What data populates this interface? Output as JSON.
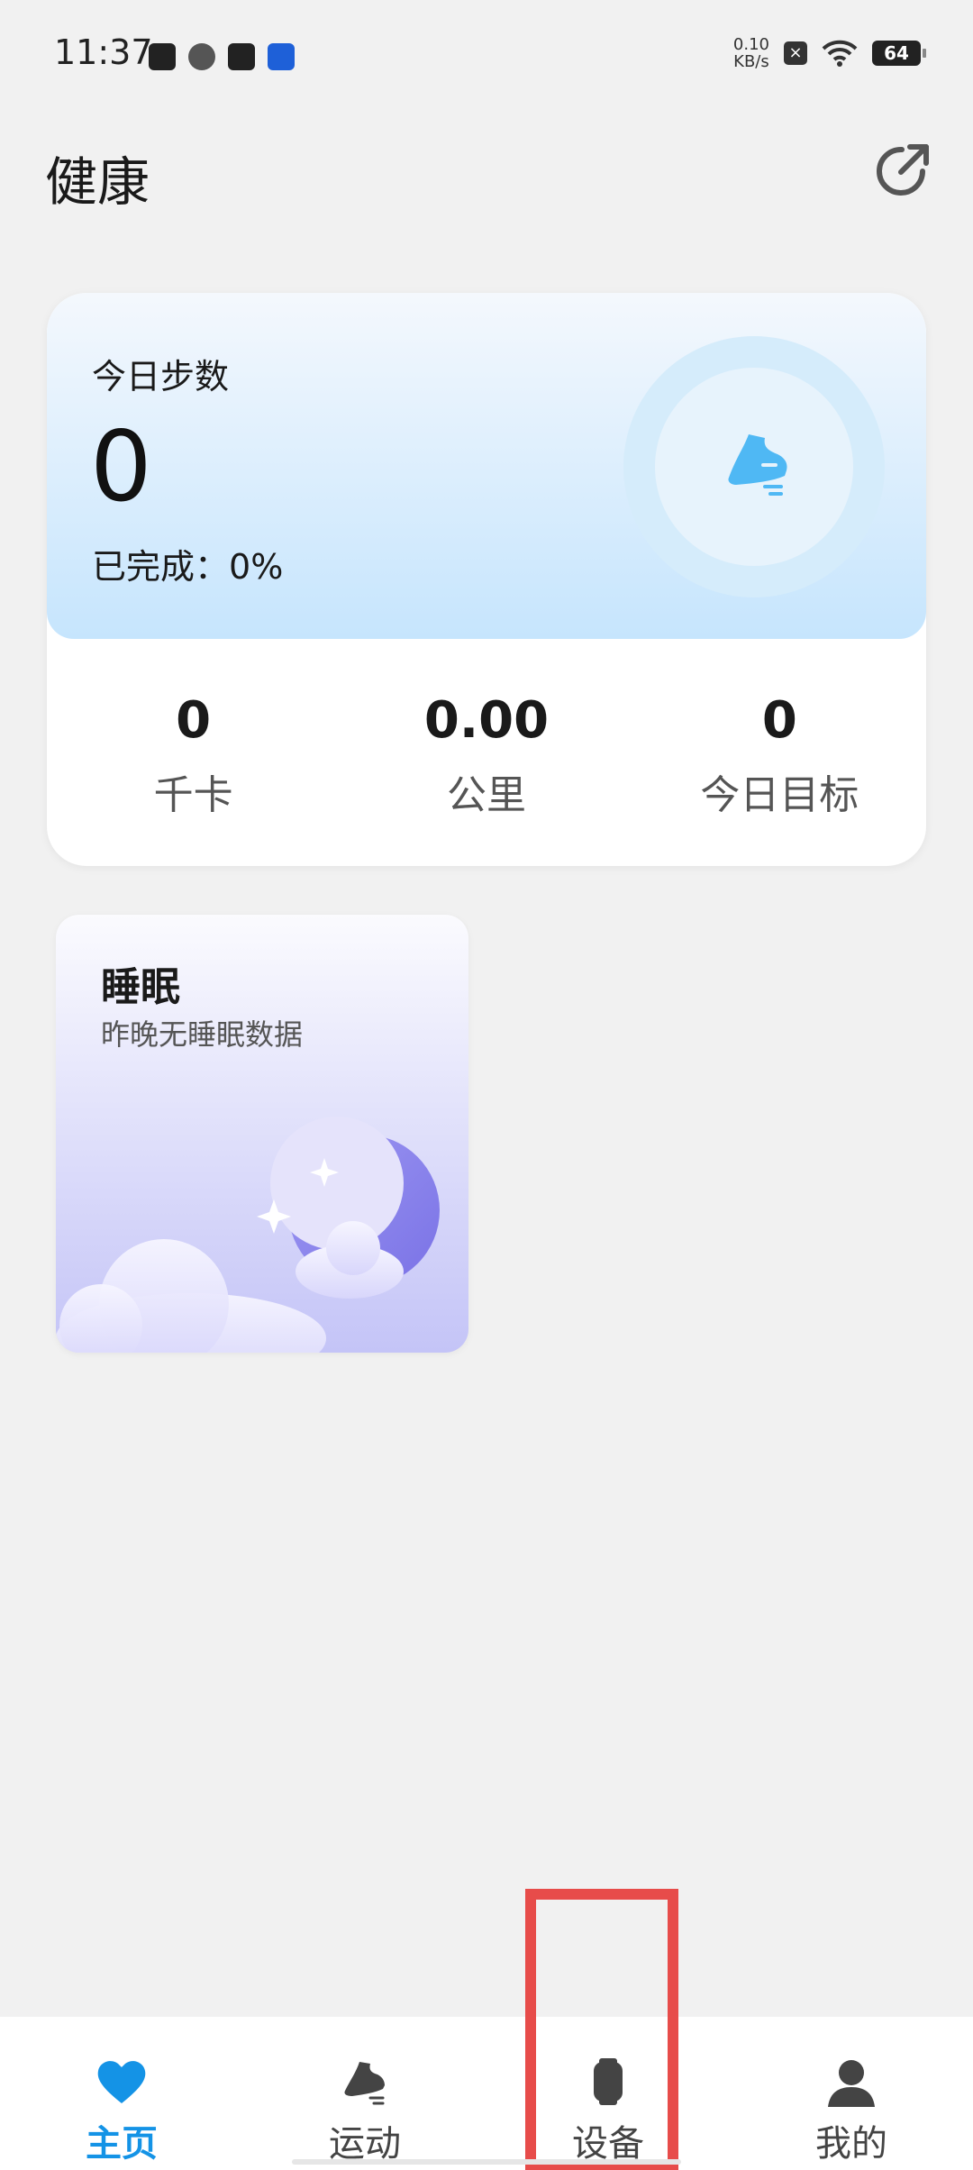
{
  "status_bar": {
    "time": "11:37",
    "net_speed_value": "0.10",
    "net_speed_unit": "KB/s",
    "battery": "64"
  },
  "header": {
    "title": "健康"
  },
  "steps_card": {
    "label": "今日步数",
    "value": "0",
    "completed_label": "已完成：",
    "completed_value": "0%",
    "progress_percent": 0,
    "stats": [
      {
        "value": "0",
        "label": "千卡"
      },
      {
        "value": "0.00",
        "label": "公里"
      },
      {
        "value": "0",
        "label": "今日目标"
      }
    ]
  },
  "sleep_card": {
    "title": "睡眠",
    "subtitle": "昨晚无睡眠数据"
  },
  "bottom_nav": {
    "items": [
      {
        "label": "主页",
        "icon": "heart-icon",
        "active": true
      },
      {
        "label": "运动",
        "icon": "shoe-icon",
        "active": false
      },
      {
        "label": "设备",
        "icon": "watch-icon",
        "active": false
      },
      {
        "label": "我的",
        "icon": "user-icon",
        "active": false
      }
    ]
  },
  "colors": {
    "accent": "#1493e6",
    "highlight": "#e74c4a",
    "steps_gradient_bottom": "#c6e5fd",
    "sleep_gradient_bottom": "#c4c4f7"
  }
}
